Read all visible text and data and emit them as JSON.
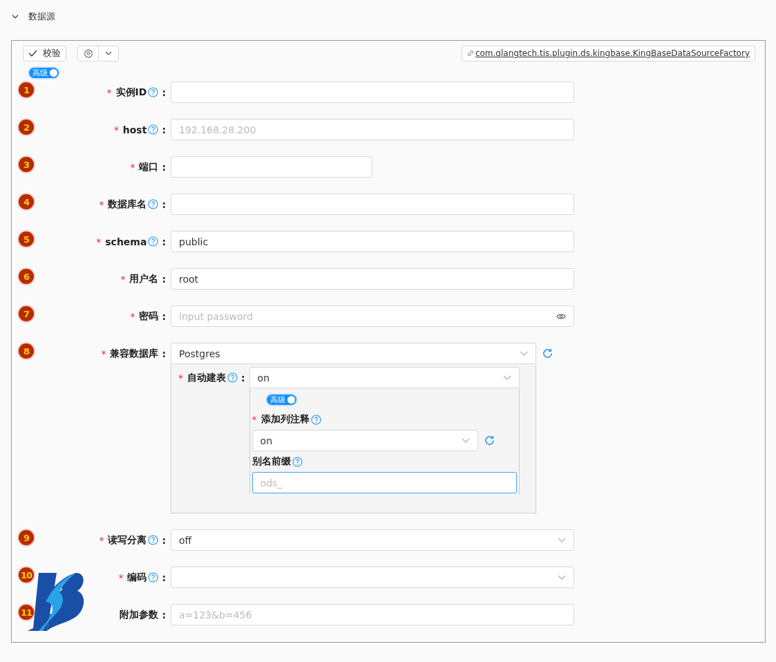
{
  "section": {
    "title": "数据源",
    "expanded": true
  },
  "toolbar": {
    "validate_button": "校验",
    "source_link": "com.qlangtech.tis.plugin.ds.kingbase.KingBaseDataSourceFactory"
  },
  "advanced_toggle": {
    "label": "高级",
    "on": true
  },
  "fields": [
    {
      "index": "1",
      "required_mark": "*",
      "label": "实例ID",
      "help": true,
      "colon": ":",
      "kind": "text"
    },
    {
      "index": "2",
      "required_mark": "*",
      "label": "host",
      "help": true,
      "colon": ":",
      "kind": "text",
      "placeholder": "192.168.28.200"
    },
    {
      "index": "3",
      "required_mark": "*",
      "label": "端口",
      "help": false,
      "colon": ":",
      "kind": "number"
    },
    {
      "index": "4",
      "required_mark": "*",
      "label": "数据库名",
      "help": true,
      "colon": ":",
      "kind": "text"
    },
    {
      "index": "5",
      "required_mark": "*",
      "label": "schema",
      "help": true,
      "colon": ":",
      "kind": "text",
      "value": "public"
    },
    {
      "index": "6",
      "required_mark": "*",
      "label": "用户名",
      "help": false,
      "colon": ":",
      "kind": "text",
      "value": "root"
    },
    {
      "index": "7",
      "required_mark": "*",
      "label": "密码",
      "help": false,
      "colon": ":",
      "kind": "password",
      "placeholder": "input password"
    },
    {
      "index": "8",
      "required_mark": "*",
      "label": "兼容数据库",
      "help": false,
      "colon": ":",
      "kind": "select",
      "value": "Postgres",
      "refresh": true,
      "sub": {
        "required_mark": "*",
        "label": "自动建表",
        "help": true,
        "colon": ":",
        "value": "on",
        "advanced_toggle": {
          "label": "高级",
          "on": true
        },
        "fields": [
          {
            "required_mark": "*",
            "label": "添加列注释",
            "help": true,
            "kind": "select",
            "value": "on",
            "refresh": true
          },
          {
            "label": "别名前缀",
            "help": true,
            "kind": "text",
            "placeholder": "ods_",
            "focused": true
          }
        ]
      }
    },
    {
      "index": "9",
      "required_mark": "*",
      "label": "读写分离",
      "help": true,
      "colon": ":",
      "kind": "select",
      "value": "off"
    },
    {
      "index": "10",
      "required_mark": "*",
      "label": "编码",
      "help": true,
      "colon": ":",
      "kind": "select"
    },
    {
      "index": "11",
      "label": "附加参数",
      "help": false,
      "colon": ":",
      "kind": "text",
      "placeholder": "a=123&b=456"
    }
  ]
}
